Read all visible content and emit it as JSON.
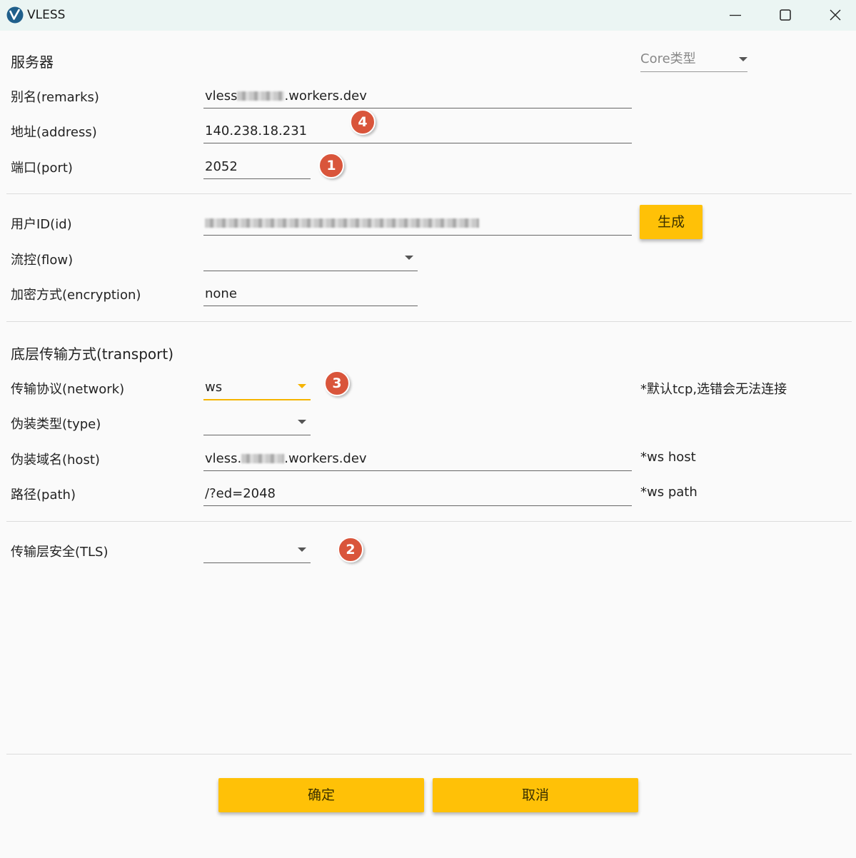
{
  "window": {
    "title": "VLESS",
    "controls": [
      "minimize-icon",
      "maximize-icon",
      "close-icon"
    ]
  },
  "server": {
    "section_title": "服务器",
    "core_type": {
      "placeholder": "Core类型",
      "value": ""
    },
    "remarks": {
      "label": "别名(remarks)",
      "prefix": "vless",
      "suffix": ".workers.dev"
    },
    "address": {
      "label": "地址(address)",
      "value": "140.238.18.231"
    },
    "port": {
      "label": "端口(port)",
      "value": "2052"
    },
    "user_id": {
      "label": "用户ID(id)",
      "value": ""
    },
    "generate_button": "生成",
    "flow": {
      "label": "流控(flow)",
      "value": ""
    },
    "encryption": {
      "label": "加密方式(encryption)",
      "value": "none"
    }
  },
  "transport": {
    "section_title": "底层传输方式(transport)",
    "network": {
      "label": "传输协议(network)",
      "value": "ws",
      "hint": "*默认tcp,选错会无法连接"
    },
    "type": {
      "label": "伪装类型(type)",
      "value": ""
    },
    "host": {
      "label": "伪装域名(host)",
      "prefix": "vless.",
      "suffix": ".workers.dev",
      "hint": "*ws host"
    },
    "path": {
      "label": "路径(path)",
      "value": "/?ed=2048",
      "hint": "*ws path"
    },
    "tls": {
      "label": "传输层安全(TLS)",
      "value": ""
    }
  },
  "annotations": {
    "port_badge": "1",
    "tls_badge": "2",
    "network_badge": "3",
    "address_badge": "4"
  },
  "footer": {
    "confirm_label": "确定",
    "cancel_label": "取消"
  },
  "colors": {
    "accent": "#ffc107",
    "badge": "#d9553b",
    "titlebar": "#ebf5f3"
  }
}
